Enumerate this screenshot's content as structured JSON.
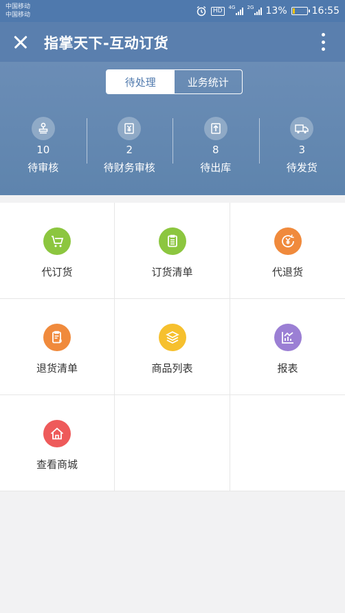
{
  "status_bar": {
    "carrier_1": "中国移动",
    "carrier_2": "中国移动",
    "hd": "HD",
    "net_1": "4G",
    "net_2": "2G",
    "battery": "13%",
    "battery_level": 0.13,
    "time": "16:55"
  },
  "titlebar": {
    "title": "指掌天下-互动订货",
    "close_icon": "close-icon",
    "more_icon": "more-vertical-icon"
  },
  "tabs": [
    {
      "label": "待处理",
      "active": true
    },
    {
      "label": "业务统计",
      "active": false
    }
  ],
  "stats": [
    {
      "count": "10",
      "label": "待审核",
      "icon": "stamp-icon"
    },
    {
      "count": "2",
      "label": "待财务审核",
      "icon": "finance-icon"
    },
    {
      "count": "8",
      "label": "待出库",
      "icon": "outbound-icon"
    },
    {
      "count": "3",
      "label": "待发货",
      "icon": "truck-icon"
    }
  ],
  "menu": [
    {
      "label": "代订货",
      "icon": "cart-icon",
      "color": "#8cc63f"
    },
    {
      "label": "订货清单",
      "icon": "clipboard-icon",
      "color": "#8cc63f"
    },
    {
      "label": "代退货",
      "icon": "refund-icon",
      "color": "#f08a3c"
    },
    {
      "label": "退货清单",
      "icon": "return-list-icon",
      "color": "#f08a3c"
    },
    {
      "label": "商品列表",
      "icon": "layers-icon",
      "color": "#f6c02e"
    },
    {
      "label": "报表",
      "icon": "chart-icon",
      "color": "#9b7fd4"
    },
    {
      "label": "查看商城",
      "icon": "home-icon",
      "color": "#ee5a5a"
    }
  ],
  "colors": {
    "header": "#5a7fae",
    "accent": "#4f79ad"
  }
}
